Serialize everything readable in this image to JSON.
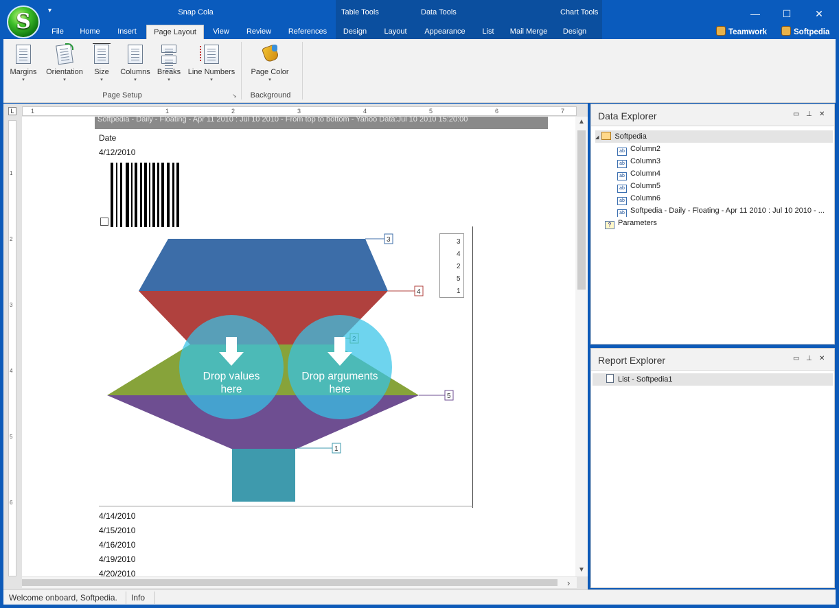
{
  "window": {
    "title": "Snap Cola",
    "logo_letter": "S",
    "qat_caret": "▾",
    "minimize": "—",
    "maximize": "☐",
    "close": "✕"
  },
  "context_groups": [
    {
      "label": "Table Tools"
    },
    {
      "label": "Data Tools"
    },
    {
      "label": "Chart Tools"
    }
  ],
  "tabs": [
    {
      "label": "File"
    },
    {
      "label": "Home"
    },
    {
      "label": "Insert"
    },
    {
      "label": "Page Layout"
    },
    {
      "label": "View"
    },
    {
      "label": "Review"
    },
    {
      "label": "References"
    },
    {
      "label": "Design"
    },
    {
      "label": "Layout"
    },
    {
      "label": "Appearance"
    },
    {
      "label": "List"
    },
    {
      "label": "Mail Merge"
    },
    {
      "label": "Design"
    }
  ],
  "user_links": {
    "teamwork": "Teamwork",
    "user": "Softpedia"
  },
  "ribbon": {
    "page_setup": {
      "label": "Page Setup",
      "buttons": [
        {
          "label": "Margins"
        },
        {
          "label": "Orientation"
        },
        {
          "label": "Size"
        },
        {
          "label": "Columns"
        },
        {
          "label": "Breaks"
        },
        {
          "label": "Line Numbers"
        }
      ]
    },
    "background": {
      "label": "Background",
      "buttons": [
        {
          "label": "Page Color"
        }
      ]
    },
    "caret": "▾",
    "launcher": "↘"
  },
  "ruler": {
    "corner": "L",
    "h_numbers": [
      "1",
      "1",
      "2",
      "3",
      "4",
      "5",
      "6",
      "7"
    ],
    "v_numbers": [
      "1",
      "2",
      "3",
      "4",
      "5",
      "6"
    ]
  },
  "document": {
    "header_text": "Softpedia - Daily - Floating - Apr 11 2010 : Jul 10 2010 - From top to bottom - Yahoo Data:Jul 10 2010 15:20:00",
    "date_label": "Date",
    "dates_top": [
      "4/12/2010"
    ],
    "dates_bottom": [
      "4/14/2010",
      "4/15/2010",
      "4/16/2010",
      "4/19/2010",
      "4/20/2010"
    ]
  },
  "chart": {
    "type": "funnel",
    "point_labels": [
      "3",
      "4",
      "2",
      "5",
      "1"
    ],
    "colors": {
      "3": "#3c6da8",
      "4": "#b0413e",
      "2": "#87a33a",
      "5": "#6e4e91",
      "1": "#3e9aad"
    },
    "legend": [
      {
        "label": "3",
        "color": "#3c6da8"
      },
      {
        "label": "4",
        "color": "#b0413e"
      },
      {
        "label": "2",
        "color": "#87a33a"
      },
      {
        "label": "5",
        "color": "#6e4e91"
      },
      {
        "label": "1",
        "color": "#3e9aad"
      }
    ],
    "drop_values_line1": "Drop values",
    "drop_values_line2": "here",
    "drop_arguments_line1": "Drop arguments",
    "drop_arguments_line2": "here"
  },
  "data_explorer": {
    "title": "Data Explorer",
    "root": "Softpedia",
    "expander": "◢",
    "columns": [
      "Column2",
      "Column3",
      "Column4",
      "Column5",
      "Column6",
      "Softpedia - Daily - Floating - Apr 11 2010 : Jul 10 2010 - ..."
    ],
    "field_icon": "ab",
    "parameters": "Parameters",
    "param_icon": "?"
  },
  "report_explorer": {
    "title": "Report Explorer",
    "items": [
      "List - Softpedia1"
    ]
  },
  "panel_buttons": {
    "window": "▭",
    "pin": "⊥",
    "close": "✕"
  },
  "scroll": {
    "up": "▲",
    "down": "▼",
    "left": "‹",
    "right": "›"
  },
  "status": {
    "message": "Welcome onboard, Softpedia.",
    "info": "Info"
  }
}
